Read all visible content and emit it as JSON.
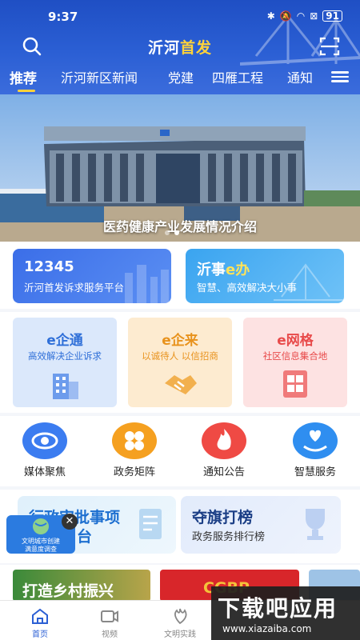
{
  "status_bar": {
    "time": "9:37",
    "battery": "91"
  },
  "header": {
    "title_part1": "沂河",
    "title_part2": "首发",
    "tabs": [
      "推荐",
      "沂河新区新闻",
      "党建",
      "四雁工程",
      "通知"
    ]
  },
  "banner": {
    "caption": "医药健康产业发展情况介绍"
  },
  "service_cards": [
    {
      "title": "12345",
      "subtitle": "沂河首发诉求服务平台"
    },
    {
      "title_part1": "沂事",
      "title_part2": "e办",
      "subtitle": "智慧、高效解决大小事"
    }
  ],
  "e_cards": [
    {
      "title": "e企通",
      "subtitle": "高效解决企业诉求",
      "color": "#2f6fd8"
    },
    {
      "title": "e企来",
      "subtitle": "以诚待人 以信招商",
      "color": "#e8921c"
    },
    {
      "title": "e网格",
      "subtitle": "社区信息集合地",
      "color": "#e84a4a"
    }
  ],
  "quick_actions": [
    {
      "label": "媒体聚焦",
      "icon": "eye-icon",
      "color": "#3b7cf0"
    },
    {
      "label": "政务矩阵",
      "icon": "clover-icon",
      "color": "#f5a020"
    },
    {
      "label": "通知公告",
      "icon": "flame-icon",
      "color": "#ef4a44"
    },
    {
      "label": "智慧服务",
      "icon": "heart-hand-icon",
      "color": "#2f8ef0"
    }
  ],
  "feature_cards": [
    {
      "title": "行政审批事项",
      "subtitle": "台"
    },
    {
      "title": "夺旗打榜",
      "subtitle": "政务服务排行榜"
    }
  ],
  "floating_badge": {
    "line1": "文明城市创建",
    "line2": "满意度调查"
  },
  "news_strip": [
    "打造乡村振兴",
    "CGBP"
  ],
  "tab_bar": [
    {
      "label": "首页",
      "icon": "home-icon"
    },
    {
      "label": "视频",
      "icon": "video-icon"
    },
    {
      "label": "文明实践",
      "icon": "practice-icon"
    }
  ],
  "watermark": {
    "title": "下载吧应用",
    "url": "www.xiazaiba.com"
  }
}
